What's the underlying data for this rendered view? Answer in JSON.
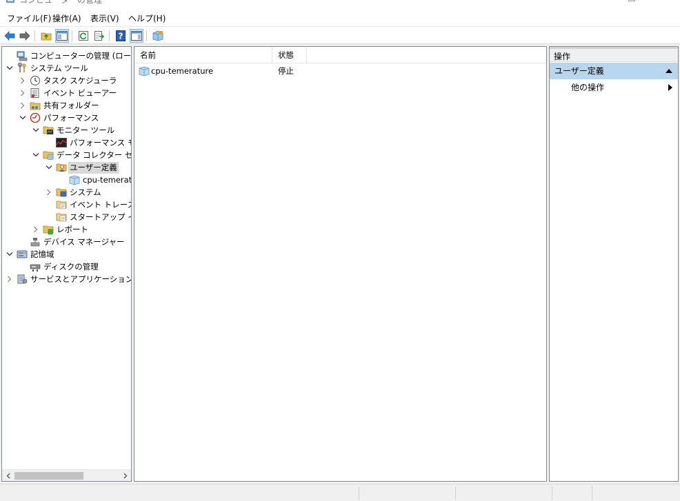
{
  "window": {
    "title": "コンピューターの管理"
  },
  "menu": [
    {
      "label": "ファイル(F)"
    },
    {
      "label": "操作(A)"
    },
    {
      "label": "表示(V)"
    },
    {
      "label": "ヘルプ(H)"
    }
  ],
  "tree": [
    {
      "label": "コンピューターの管理 (ローカル)",
      "icon": "computer-management-icon",
      "expander": "none",
      "level": 0
    },
    {
      "label": "システム ツール",
      "icon": "system-tools-icon",
      "expander": "expanded",
      "level": 0
    },
    {
      "label": "タスク スケジューラ",
      "icon": "clock-icon",
      "expander": "collapsed",
      "level": 1
    },
    {
      "label": "イベント ビューアー",
      "icon": "event-viewer-icon",
      "expander": "collapsed",
      "level": 1
    },
    {
      "label": "共有フォルダー",
      "icon": "shared-folder-icon",
      "expander": "collapsed",
      "level": 1
    },
    {
      "label": "パフォーマンス",
      "icon": "performance-icon",
      "expander": "expanded",
      "level": 1
    },
    {
      "label": "モニター ツール",
      "icon": "folder-monitor-icon",
      "expander": "expanded",
      "level": 2
    },
    {
      "label": "パフォーマンス モニタ",
      "icon": "perf-monitor-icon",
      "expander": "none",
      "level": 3
    },
    {
      "label": "データ コレクター セット",
      "icon": "folder-collector-icon",
      "expander": "expanded",
      "level": 2
    },
    {
      "label": "ユーザー定義",
      "icon": "user-defined-icon",
      "expander": "expanded",
      "level": 3,
      "selected": true
    },
    {
      "label": "cpu-temeratu",
      "icon": "collector-set-icon",
      "expander": "none",
      "level": 4
    },
    {
      "label": "システム",
      "icon": "system-collector-icon",
      "expander": "collapsed",
      "level": 3
    },
    {
      "label": "イベント トレース セ",
      "icon": "trace-folder-icon",
      "expander": "none",
      "level": 3
    },
    {
      "label": "スタートアップ イベン",
      "icon": "trace-folder-icon",
      "expander": "none",
      "level": 3
    },
    {
      "label": "レポート",
      "icon": "report-icon",
      "expander": "collapsed",
      "level": 2
    },
    {
      "label": "デバイス マネージャー",
      "icon": "device-manager-icon",
      "expander": "none",
      "level": 1
    },
    {
      "label": "記憶域",
      "icon": "storage-icon",
      "expander": "expanded",
      "level": 0
    },
    {
      "label": "ディスクの管理",
      "icon": "disk-management-icon",
      "expander": "none",
      "level": 1
    },
    {
      "label": "サービスとアプリケーション",
      "icon": "services-icon",
      "expander": "collapsed",
      "level": 0
    }
  ],
  "list": {
    "columns": [
      "名前",
      "状態"
    ],
    "rows": [
      {
        "name": "cpu-temerature",
        "status": "停止",
        "icon": "collector-set-icon"
      }
    ]
  },
  "actions": {
    "header": "操作",
    "section": "ユーザー定義",
    "items": [
      {
        "label": "他の操作"
      }
    ]
  },
  "colors": {
    "selection": "#d9d9d9",
    "action_section": "#b9d6ef",
    "accent": "#2f7fd1"
  }
}
